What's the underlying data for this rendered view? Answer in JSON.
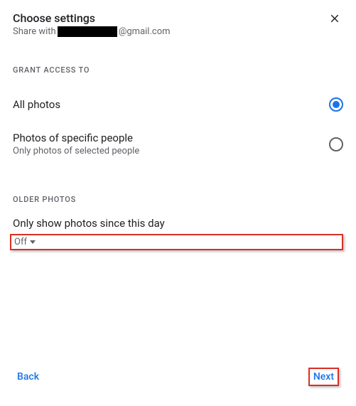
{
  "header": {
    "title": "Choose settings",
    "subtitle_prefix": "Share with",
    "subtitle_suffix": "@gmail.com"
  },
  "sections": {
    "grant_label": "GRANT ACCESS TO",
    "older_label": "OLDER PHOTOS"
  },
  "options": {
    "all_photos": {
      "title": "All photos",
      "selected": true
    },
    "specific": {
      "title": "Photos of specific people",
      "sub": "Only photos of selected people",
      "selected": false
    }
  },
  "date_filter": {
    "label": "Only show photos since this day",
    "value": "Off"
  },
  "footer": {
    "back": "Back",
    "next": "Next"
  }
}
